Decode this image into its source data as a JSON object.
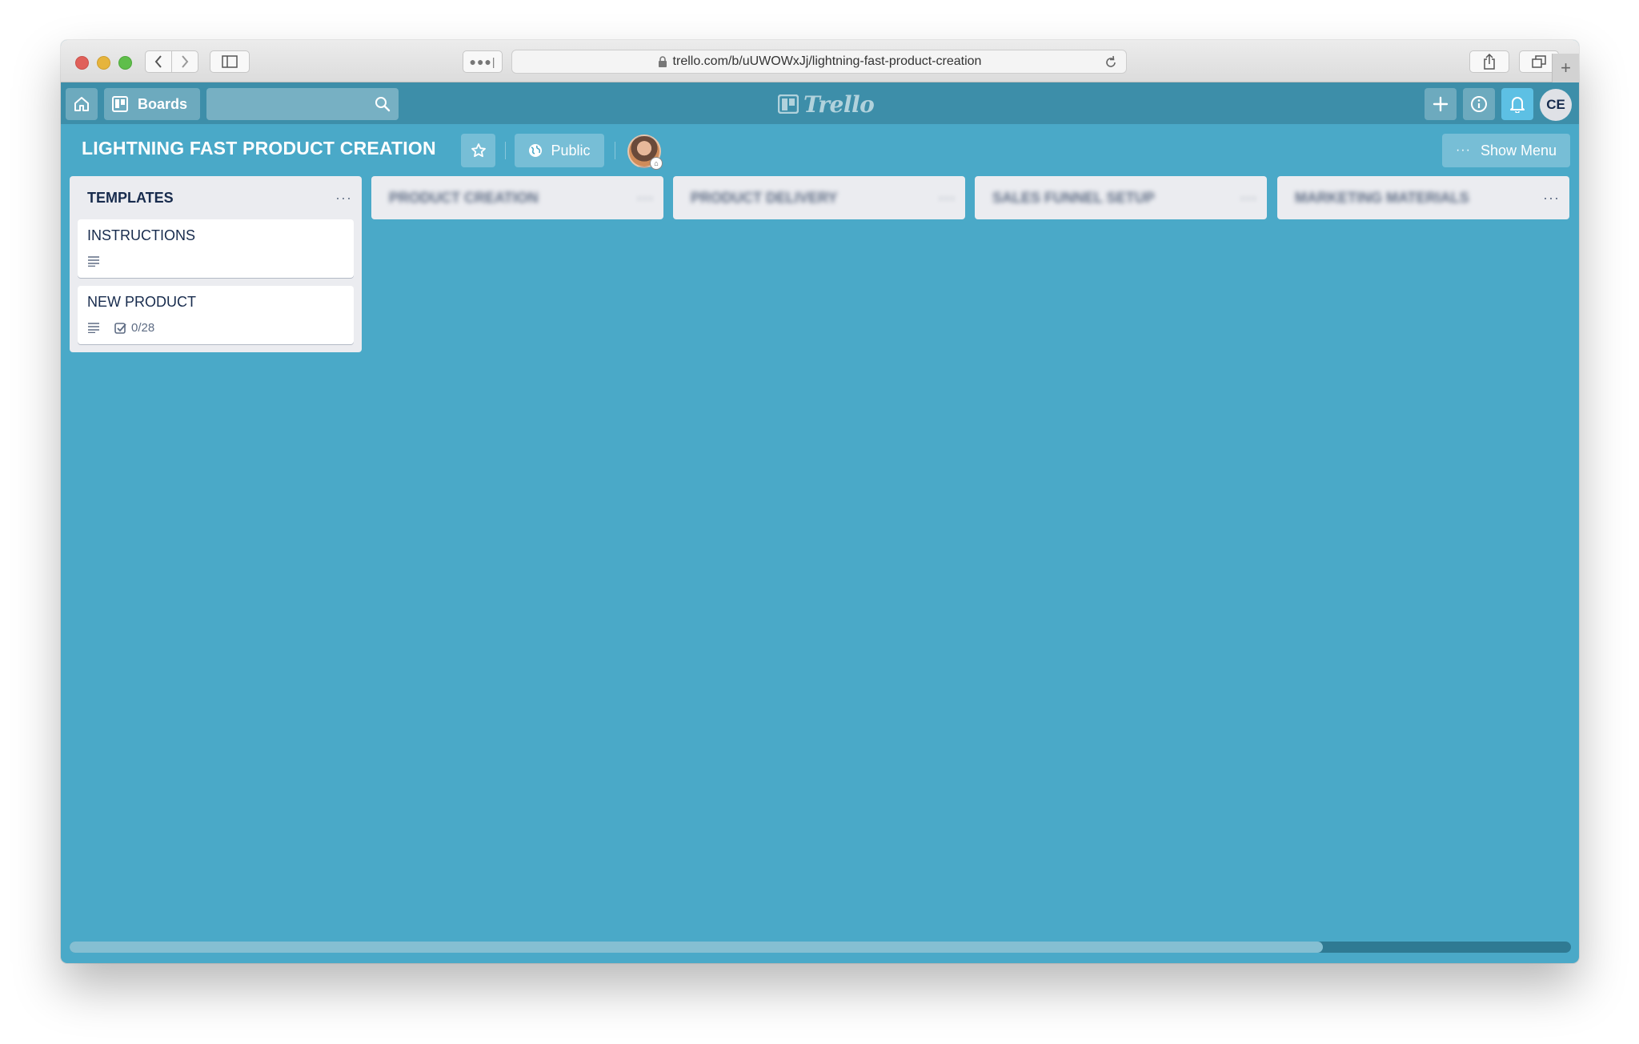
{
  "browser": {
    "url": "trello.com/b/uUWOWxJj/lightning-fast-product-creation"
  },
  "header": {
    "boards_label": "Boards",
    "logo_text": "Trello",
    "avatar_initials": "CE"
  },
  "board": {
    "title": "LIGHTNING FAST PRODUCT CREATION",
    "visibility": "Public",
    "show_menu_label": "Show Menu",
    "background_color": "#4aa9c8"
  },
  "lists": [
    {
      "title": "TEMPLATES",
      "menu": "···",
      "cards": [
        {
          "title": "INSTRUCTIONS",
          "has_description": true
        },
        {
          "title": "NEW PRODUCT",
          "has_description": true,
          "checklist": "0/28"
        }
      ]
    },
    {
      "title": "PRODUCT CREATION",
      "menu": "···",
      "blurred": true
    },
    {
      "title": "PRODUCT DELIVERY",
      "menu": "···",
      "blurred": true
    },
    {
      "title": "SALES FUNNEL SETUP",
      "menu": "···",
      "blurred": true
    },
    {
      "title": "MARKETING MATERIALS",
      "menu": "···",
      "blurred": true
    }
  ],
  "icons": {
    "home": "home-icon",
    "boards": "boards-icon",
    "search": "search-icon",
    "plus": "plus-icon",
    "info": "info-icon",
    "bell": "bell-icon",
    "star": "star-icon",
    "globe": "globe-icon",
    "description": "description-icon",
    "checklist": "checklist-icon"
  },
  "scroll": {
    "horizontal_thumb_fraction": 0.835
  }
}
